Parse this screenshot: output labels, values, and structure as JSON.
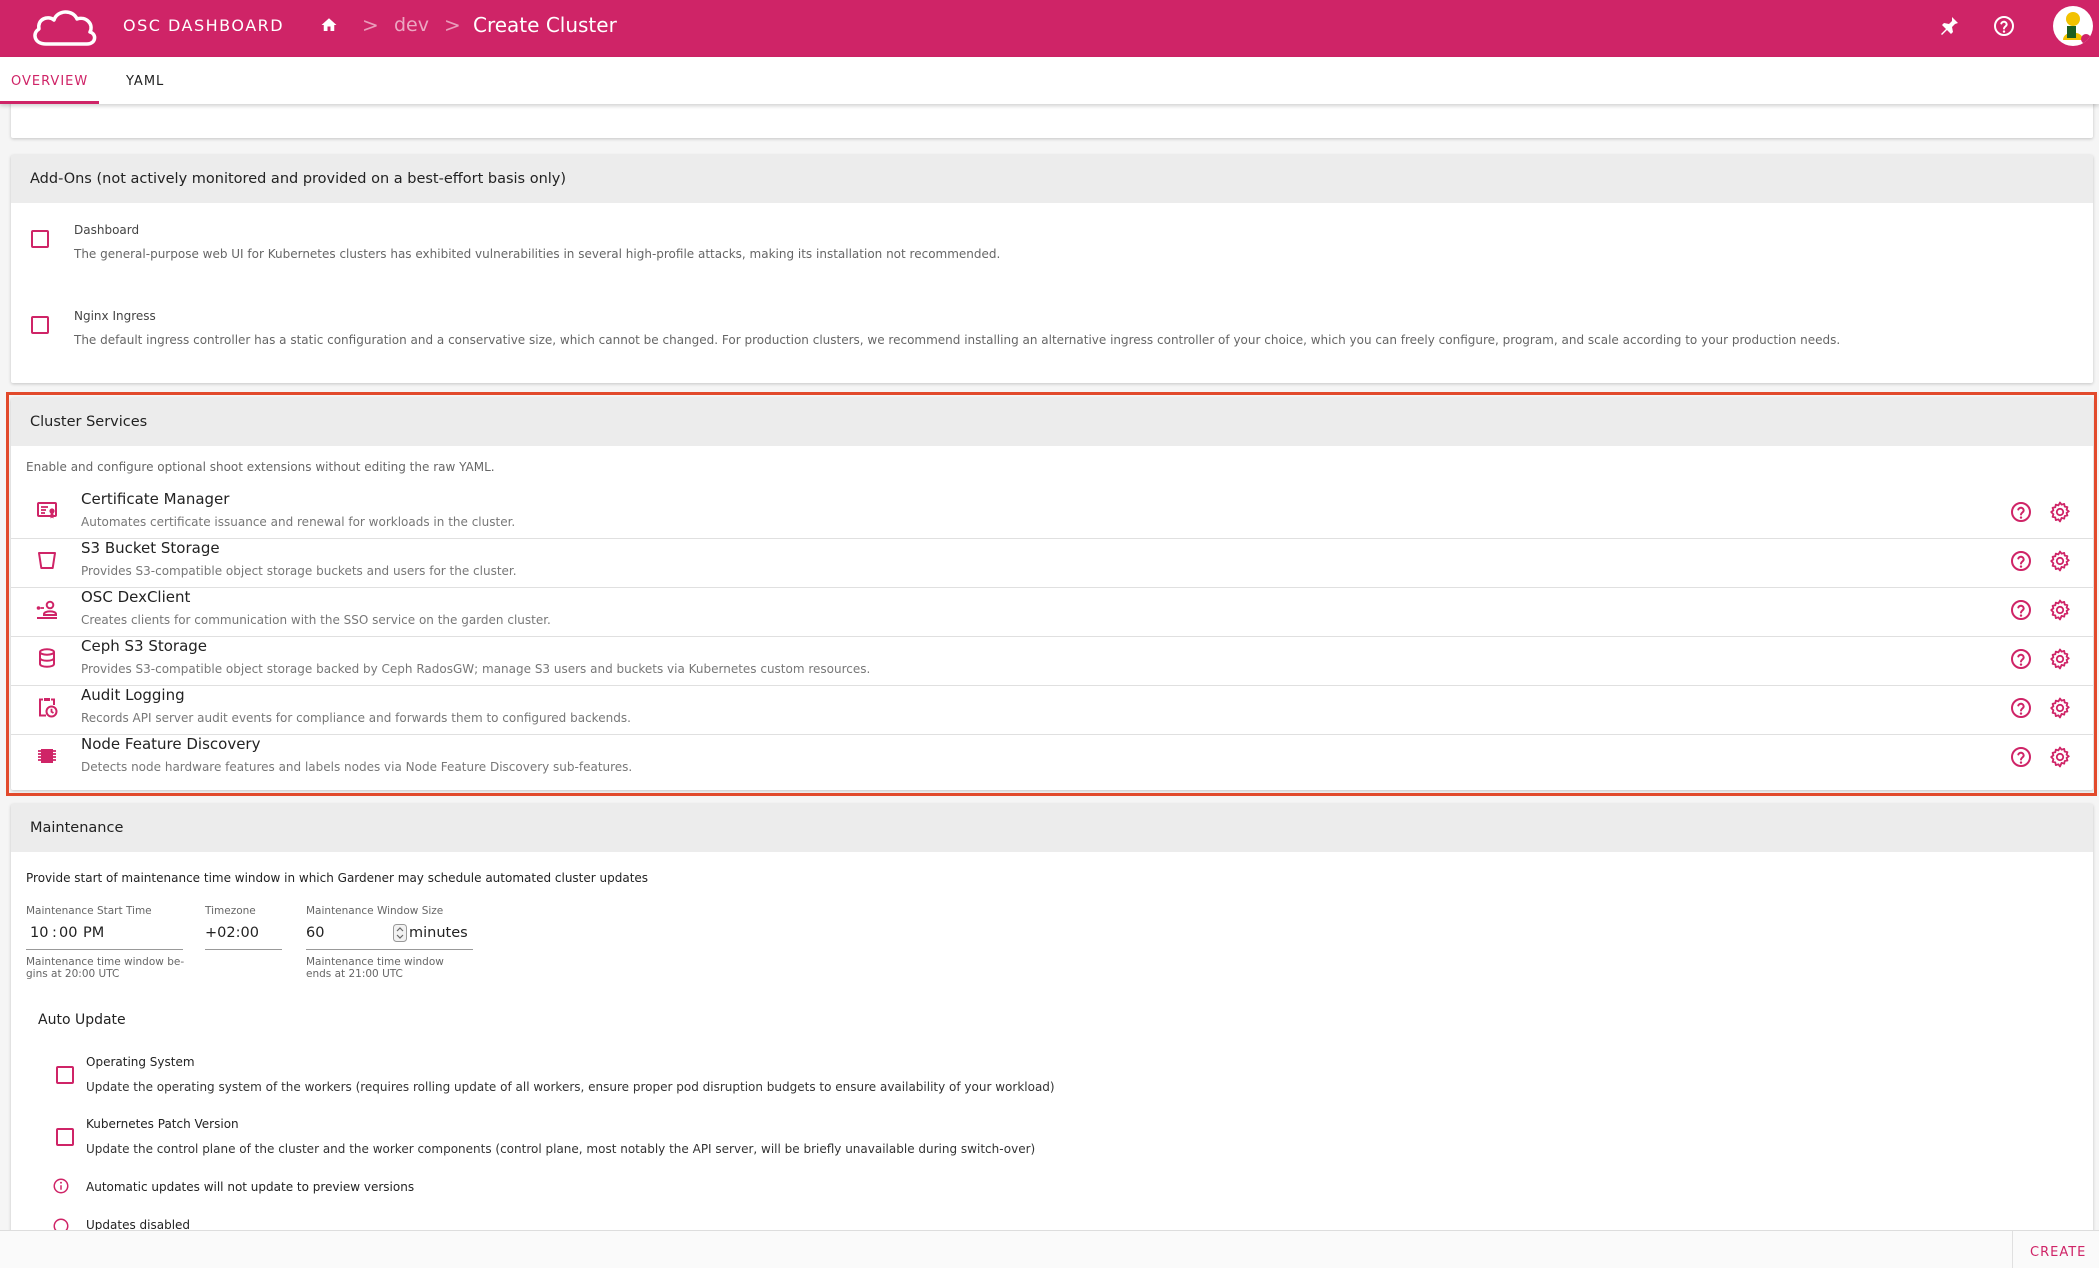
{
  "appbar": {
    "brand": "OSC DASHBOARD",
    "breadcrumb_dev": "dev",
    "breadcrumb_title": "Create Cluster",
    "breadcrumb_sep": ">"
  },
  "tabs": [
    {
      "label": "OVERVIEW",
      "active": true
    },
    {
      "label": "YAML",
      "active": false
    }
  ],
  "addons": {
    "title": "Add-Ons (not actively monitored and provided on a best-effort basis only)",
    "items": [
      {
        "label": "Dashboard",
        "description": "The general-purpose web UI for Kubernetes clusters has exhibited vulnerabilities in several high-profile attacks, making its installation not recommended.",
        "checked": false
      },
      {
        "label": "Nginx Ingress",
        "description": "The default ingress controller has a static configuration and a conservative size, which cannot be changed. For production clusters, we recommend installing an alternative ingress controller of your choice, which you can freely configure, program, and scale according to your production needs.",
        "checked": false
      }
    ]
  },
  "cluster_services": {
    "title": "Cluster Services",
    "intro": "Enable and configure optional shoot extensions without editing the raw YAML.",
    "services": [
      {
        "name": "Certificate Manager",
        "description": "Automates certificate issuance and renewal for workloads in the cluster.",
        "icon": "certificate-icon"
      },
      {
        "name": "S3 Bucket Storage",
        "description": "Provides S3-compatible object storage buckets and users for the cluster.",
        "icon": "bucket-icon"
      },
      {
        "name": "OSC DexClient",
        "description": "Creates clients for communication with the SSO service on the garden cluster.",
        "icon": "account-network-icon"
      },
      {
        "name": "Ceph S3 Storage",
        "description": "Provides S3-compatible object storage backed by Ceph RadosGW; manage S3 users and buckets via Kubernetes custom resources.",
        "icon": "database-icon"
      },
      {
        "name": "Audit Logging",
        "description": "Records API server audit events for compliance and forwards them to configured backends.",
        "icon": "clipboard-clock-icon"
      },
      {
        "name": "Node Feature Discovery",
        "description": "Detects node hardware features and labels nodes via Node Feature Discovery sub-features.",
        "icon": "chip-icon"
      }
    ]
  },
  "maintenance": {
    "title": "Maintenance",
    "intro": "Provide start of maintenance time window in which Gardener may schedule automated cluster updates",
    "start_time": {
      "label": "Maintenance Start Time",
      "hour": "10",
      "minute": "00",
      "ampm": "PM",
      "hint_line1": "Maintenance time window be-",
      "hint_line2": "gins at 20:00 UTC"
    },
    "timezone": {
      "label": "Timezone",
      "value": "+02:00"
    },
    "window_size": {
      "label": "Maintenance Window Size",
      "value": "60",
      "unit": "minutes",
      "hint_line1": "Maintenance time window",
      "hint_line2": "ends at 21:00 UTC"
    },
    "auto_update": {
      "title": "Auto Update",
      "os": {
        "label": "Operating System",
        "description": "Update the operating system of the workers (requires rolling update of all workers, ensure proper pod disruption budgets to ensure availability of your workload)",
        "checked": false
      },
      "k8s": {
        "label": "Kubernetes Patch Version",
        "description": "Update the control plane of the cluster and the worker components (control plane, most notably the API server, will be briefly unavailable during switch-over)",
        "checked": false
      },
      "info": "Automatic updates will not update to preview versions",
      "disabled": "Updates disabled"
    }
  },
  "footer": {
    "create_label": "CREATE"
  },
  "colors": {
    "brand": "#cf2467",
    "highlight": "#e24a2c"
  }
}
